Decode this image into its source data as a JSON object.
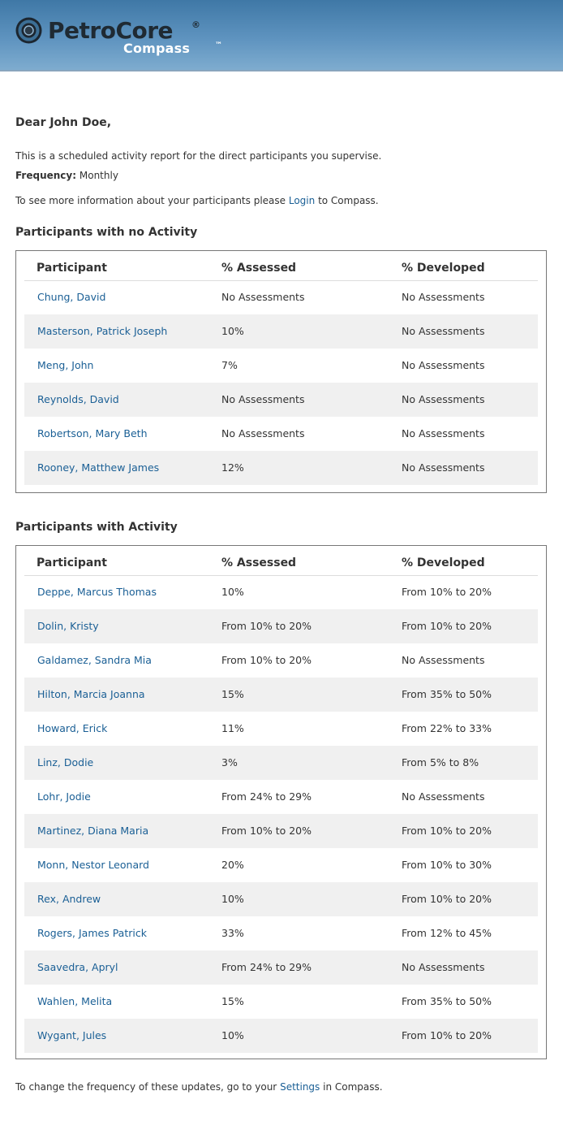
{
  "brand": {
    "name": "PetroCore",
    "registered": "®",
    "product": "Compass",
    "trademark": "™"
  },
  "email": {
    "greeting": "Dear John Doe,",
    "intro": "This is a scheduled activity report for the direct participants you supervise.",
    "frequency_label": "Frequency:",
    "frequency_value": "Monthly",
    "more_info_prefix": "To see more information about your participants please",
    "login_link": "Login",
    "more_info_suffix": "to Compass.",
    "footer_prefix": "To change the frequency of these updates, go to your",
    "settings_link": "Settings",
    "footer_suffix": "in Compass."
  },
  "columns": {
    "participant": "Participant",
    "assessed": "% Assessed",
    "developed": "% Developed"
  },
  "no_activity": {
    "title": "Participants with no Activity",
    "rows": [
      {
        "name": "Chung, David",
        "assessed": "No Assessments",
        "developed": "No Assessments"
      },
      {
        "name": "Masterson, Patrick Joseph",
        "assessed": "10%",
        "developed": "No Assessments"
      },
      {
        "name": "Meng, John",
        "assessed": "7%",
        "developed": "No Assessments"
      },
      {
        "name": "Reynolds, David",
        "assessed": "No Assessments",
        "developed": "No Assessments"
      },
      {
        "name": "Robertson, Mary Beth",
        "assessed": "No Assessments",
        "developed": "No Assessments"
      },
      {
        "name": "Rooney, Matthew James",
        "assessed": "12%",
        "developed": "No Assessments"
      }
    ]
  },
  "with_activity": {
    "title": "Participants with Activity",
    "rows": [
      {
        "name": "Deppe, Marcus Thomas",
        "assessed": "10%",
        "developed": "From 10% to 20%"
      },
      {
        "name": "Dolin, Kristy",
        "assessed": "From 10% to 20%",
        "developed": "From 10% to 20%"
      },
      {
        "name": "Galdamez, Sandra Mia",
        "assessed": "From 10% to 20%",
        "developed": "No Assessments"
      },
      {
        "name": "Hilton, Marcia Joanna",
        "assessed": "15%",
        "developed": "From 35% to 50%"
      },
      {
        "name": "Howard, Erick",
        "assessed": "11%",
        "developed": "From 22% to 33%"
      },
      {
        "name": "Linz, Dodie",
        "assessed": "3%",
        "developed": "From 5% to 8%"
      },
      {
        "name": "Lohr, Jodie",
        "assessed": "From 24% to 29%",
        "developed": "No Assessments"
      },
      {
        "name": "Martinez, Diana Maria",
        "assessed": "From 10% to 20%",
        "developed": "From 10% to 20%"
      },
      {
        "name": "Monn, Nestor Leonard",
        "assessed": "20%",
        "developed": "From 10% to 30%"
      },
      {
        "name": "Rex, Andrew",
        "assessed": "10%",
        "developed": "From 10% to 20%"
      },
      {
        "name": "Rogers, James Patrick",
        "assessed": "33%",
        "developed": "From 12% to 45%"
      },
      {
        "name": "Saavedra, Apryl",
        "assessed": "From 24% to 29%",
        "developed": "No Assessments"
      },
      {
        "name": "Wahlen, Melita",
        "assessed": "15%",
        "developed": "From 35% to 50%"
      },
      {
        "name": "Wygant, Jules",
        "assessed": "10%",
        "developed": "From 10% to 20%"
      }
    ]
  },
  "colors": {
    "link": "#1a5f95",
    "header_top": "#3f78a6",
    "header_bottom": "#7eaccf",
    "row_alt": "#f0f0f0"
  }
}
